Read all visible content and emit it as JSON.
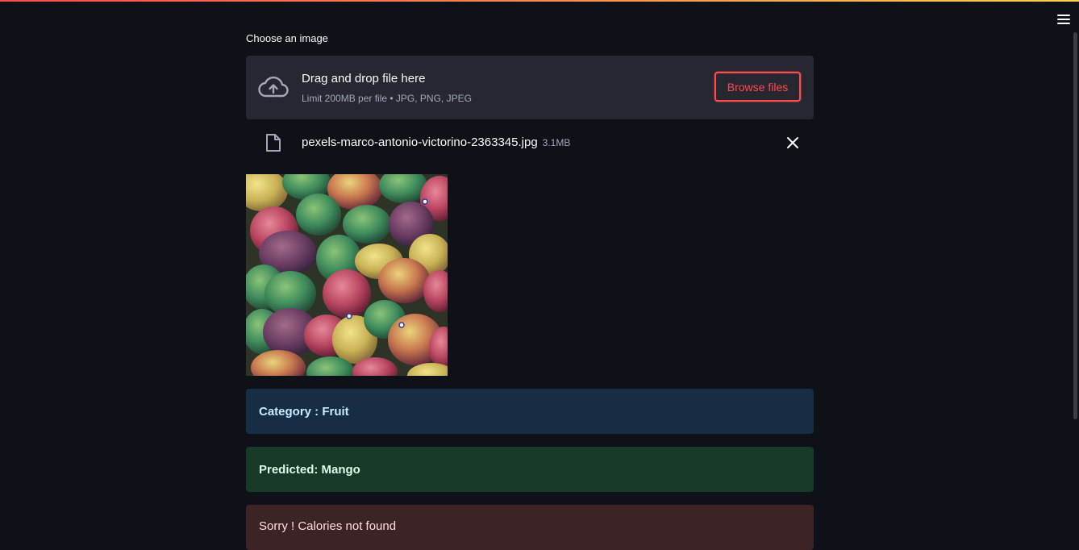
{
  "colors": {
    "background": "#0e1117",
    "accent": "#ff4b4b",
    "dropzone": "#262730",
    "info_bg": "#172d43",
    "success_bg": "#173928",
    "error_bg": "#3e2326"
  },
  "header": {
    "menu_icon": "hamburger-menu-icon"
  },
  "uploader": {
    "label": "Choose an image",
    "drop_title": "Drag and drop file here",
    "limit_text": "Limit 200MB per file • JPG, PNG, JPEG",
    "browse_label": "Browse files",
    "upload_icon": "cloud-upload-icon"
  },
  "file": {
    "name": "pexels-marco-antonio-victorino-2363345.jpg",
    "size": "3.1MB",
    "icon": "file-icon",
    "remove_icon": "close-icon"
  },
  "preview": {
    "subject": "pile of mangoes"
  },
  "results": {
    "category": "Category : Fruit",
    "predicted": "Predicted: Mango",
    "calories": "Sorry ! Calories not found"
  }
}
